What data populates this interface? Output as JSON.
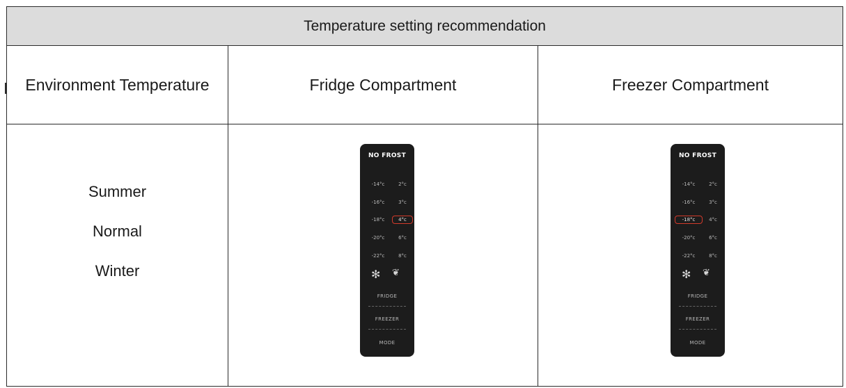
{
  "table": {
    "title": "Temperature setting recommendation",
    "headers": {
      "environment": "Environment Temperature",
      "fridge": "Fridge Compartment",
      "freezer": "Freezer Compartment"
    },
    "environments": [
      "Summer",
      "Normal",
      "Winter"
    ]
  },
  "panels": {
    "brand": "NO FROST",
    "left_temps": [
      "-14°c",
      "-16°c",
      "-18°c",
      "-20°c",
      "-22°c"
    ],
    "right_temps": [
      "2°c",
      "3°c",
      "4°c",
      "6°c",
      "8°c"
    ],
    "buttons": [
      "FRIDGE",
      "FREEZER",
      "MODE"
    ],
    "fridge_selected": "4°c",
    "freezer_selected": "-18°c",
    "accent_color": "#d23a2b",
    "icons": [
      "snowflake-icon",
      "eco-leaf-icon"
    ]
  }
}
